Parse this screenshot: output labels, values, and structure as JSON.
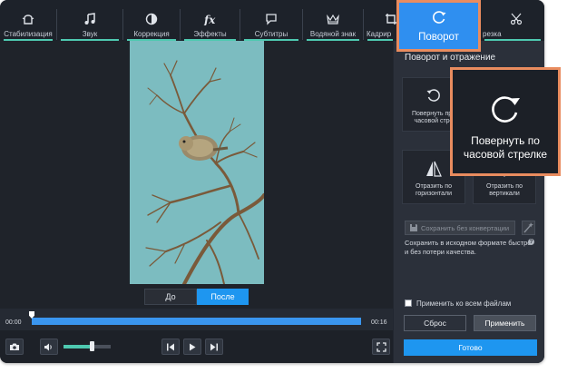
{
  "toolbar": {
    "tools": [
      {
        "label": "Стабилизация",
        "icon": "stabilization-icon"
      },
      {
        "label": "Звук",
        "icon": "music-note-icon"
      },
      {
        "label": "Коррекция",
        "icon": "color-correction-icon"
      },
      {
        "label": "Эффекты",
        "icon": "fx-icon"
      },
      {
        "label": "Субтитры",
        "icon": "speech-bubble-icon"
      },
      {
        "label": "Водяной знак",
        "icon": "watermark-crown-icon"
      },
      {
        "label": "Кадрир",
        "icon": "crop-icon"
      },
      {
        "label": "резка",
        "icon": "scissors-icon"
      }
    ]
  },
  "callout": {
    "label": "Поворот",
    "icon": "rotate-clockwise-icon"
  },
  "preview": {
    "before_label": "До",
    "after_label": "После"
  },
  "timeline": {
    "current_time": "00:00",
    "total_time": "00:16",
    "position_fraction": 0.0
  },
  "controls": {
    "volume_fraction": 0.56
  },
  "panel": {
    "title": "Поворот и отражение",
    "rotate_ccw_label": "Повернуть про часовой стре",
    "flip_h_label": "Отразить по горизонтали",
    "flip_v_label": "Отразить по вертикали",
    "save_without_conversion": "Сохранить без конвертации",
    "save_note": "Сохранить в исходном формате быстро и без потери качества.",
    "apply_all_label": "Применить ко всем файлам",
    "reset_label": "Сброс",
    "apply_label": "Применить",
    "done_label": "Готово"
  },
  "zoom_callout": {
    "label": "Повернуть по часовой стрелке"
  },
  "colors": {
    "accent_blue": "#1e96f0",
    "callout_border": "#e98c5f",
    "teal_accent": "#4ec9b0",
    "dark_bg": "#2b303a"
  }
}
